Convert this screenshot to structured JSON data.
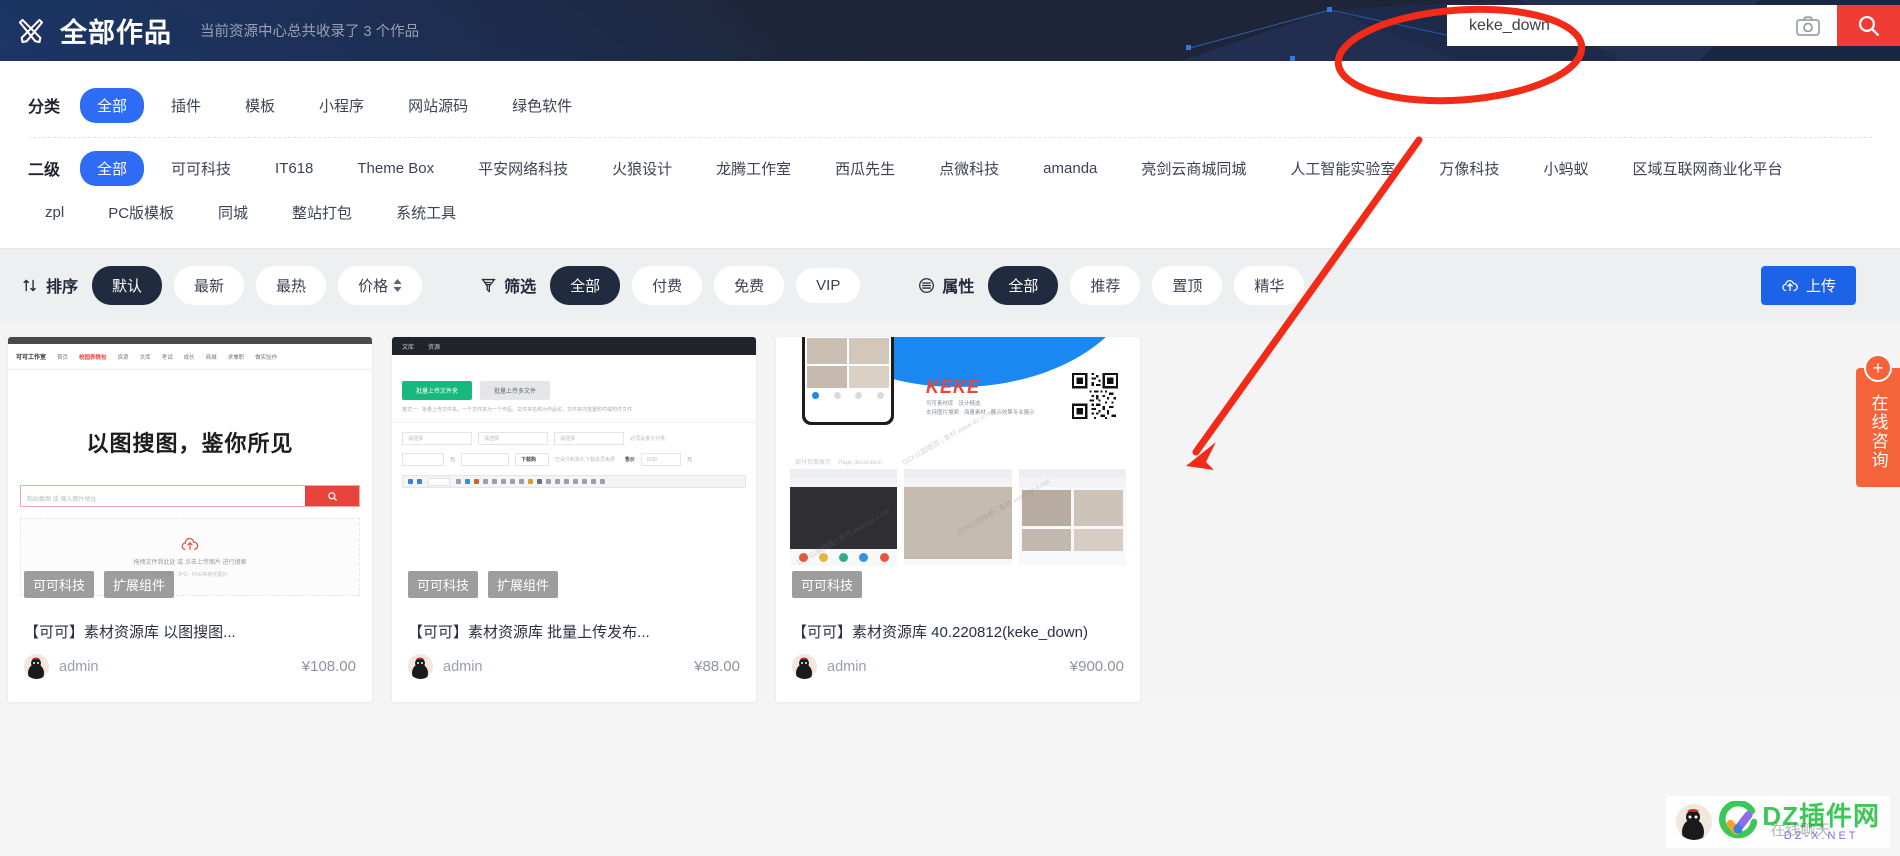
{
  "header": {
    "logo_icon": "crossed-pen-icon",
    "title": "全部作品",
    "subtitle": "当前资源中心总共收录了 3 个作品",
    "background_color": "#1e2538"
  },
  "search": {
    "value": "keke_down",
    "placeholder": "",
    "camera_icon": "camera-icon",
    "search_icon": "search-icon",
    "button_color": "#ef3d36"
  },
  "filters": {
    "category": {
      "label": "分类",
      "items": [
        "全部",
        "插件",
        "模板",
        "小程序",
        "网站源码",
        "绿色软件"
      ],
      "active": "全部",
      "active_color": "#2f6cf6"
    },
    "secondary": {
      "label": "二级",
      "items": [
        "全部",
        "可可科技",
        "IT618",
        "Theme Box",
        "平安网络科技",
        "火狼设计",
        "龙腾工作室",
        "西瓜先生",
        "点微科技",
        "amanda",
        "亮剑云商城同城",
        "人工智能实验室",
        "万像科技",
        "小蚂蚁",
        "区域互联网商业化平台"
      ],
      "items_row2": [
        "zpl",
        "PC版模板",
        "同城",
        "整站打包",
        "系统工具"
      ],
      "active": "全部"
    }
  },
  "sortbar": {
    "sort": {
      "icon": "sort-icon",
      "label": "排序",
      "items": [
        "默认",
        "最新",
        "最热",
        "价格"
      ],
      "active": "默认",
      "price_has_caret": true
    },
    "filter": {
      "icon": "funnel-icon",
      "label": "筛选",
      "items": [
        "全部",
        "付费",
        "免费",
        "VIP"
      ],
      "active": "全部"
    },
    "attribute": {
      "icon": "list-icon",
      "label": "属性",
      "items": [
        "全部",
        "推荐",
        "置顶",
        "精华"
      ],
      "active": "全部"
    },
    "upload": {
      "icon": "cloud-upload-icon",
      "label": "上传",
      "color": "#1c63e8"
    }
  },
  "side_widget": {
    "plus_icon": "plus-icon",
    "text": "在线咨询",
    "color": "#f4633a"
  },
  "cards": [
    {
      "title": "【可可】素材资源库 以图搜图...",
      "author": "admin",
      "price": "¥108.00",
      "tags": [
        "可可科技",
        "扩展组件"
      ],
      "thumb": {
        "kind": "image-search-site",
        "heading": "以图搜图，鉴你所见",
        "site_logo": "可可工作室",
        "nav": [
          "首页",
          "校园表情包",
          "资源",
          "文库",
          "考试",
          "成长",
          "商城",
          "求兼职",
          "做实验作"
        ],
        "search_placeholder": "粘贴截图 或 输入图片地址",
        "drop_text": "拖拽文件到此处 或 点击上传图片 进行搜索",
        "drop_subtext": "支持格式：JPG · PNG等格式图片"
      }
    },
    {
      "title": "【可可】素材资源库 批量上传发布...",
      "author": "admin",
      "price": "¥88.00",
      "tags": [
        "可可科技",
        "扩展组件"
      ],
      "thumb": {
        "kind": "admin-upload-form",
        "topbar": [
          "文库",
          "资源"
        ],
        "btn_primary": "批量上传文件夹",
        "btn_secondary": "批量上传多文件",
        "hint": "格式一：批量上传文件夹，一个文件夹为一个作品，文件夹名称为作品名，文件夹内放置附件或附件文件",
        "select_placeholder": "请选择",
        "select_note": "必须设置子分类",
        "price_unit": "元",
        "discount_label": "下载购",
        "discount_note": "已设分和永久下载会员免费",
        "amount_label": "售价",
        "amount_placeholder": "0.00"
      }
    },
    {
      "title": "【可可】素材资源库 40.220812(keke_down)",
      "author": "admin",
      "price": "¥900.00",
      "tags": [
        "可可科技"
      ],
      "thumb": {
        "kind": "keke-brand-mockup",
        "brand": "KEKE",
        "brand_sub_line1": "可可素材库 · 设计精选",
        "brand_sub_line2": "支持图片搜索 · 海量素材 · 展示效果专业展示",
        "section_title": "部分页面展示",
        "section_sub": "Page  decoration",
        "watermark": "DZX以图搜图 | 素材 www.dz-x.net"
      }
    }
  ],
  "watermark": {
    "main": "DZ插件网",
    "sub": "DZ-X.NET",
    "ghost": "在线聊天",
    "logo_icon": "check-circle-icon",
    "main_color": "#3cc758",
    "sub_color": "#7e6fe0"
  },
  "annotations": {
    "ellipse": {
      "name": "red-ellipse-highlight",
      "color": "#f22a18"
    },
    "arrow": {
      "name": "red-arrow-annotation",
      "color": "#f22a18"
    }
  }
}
